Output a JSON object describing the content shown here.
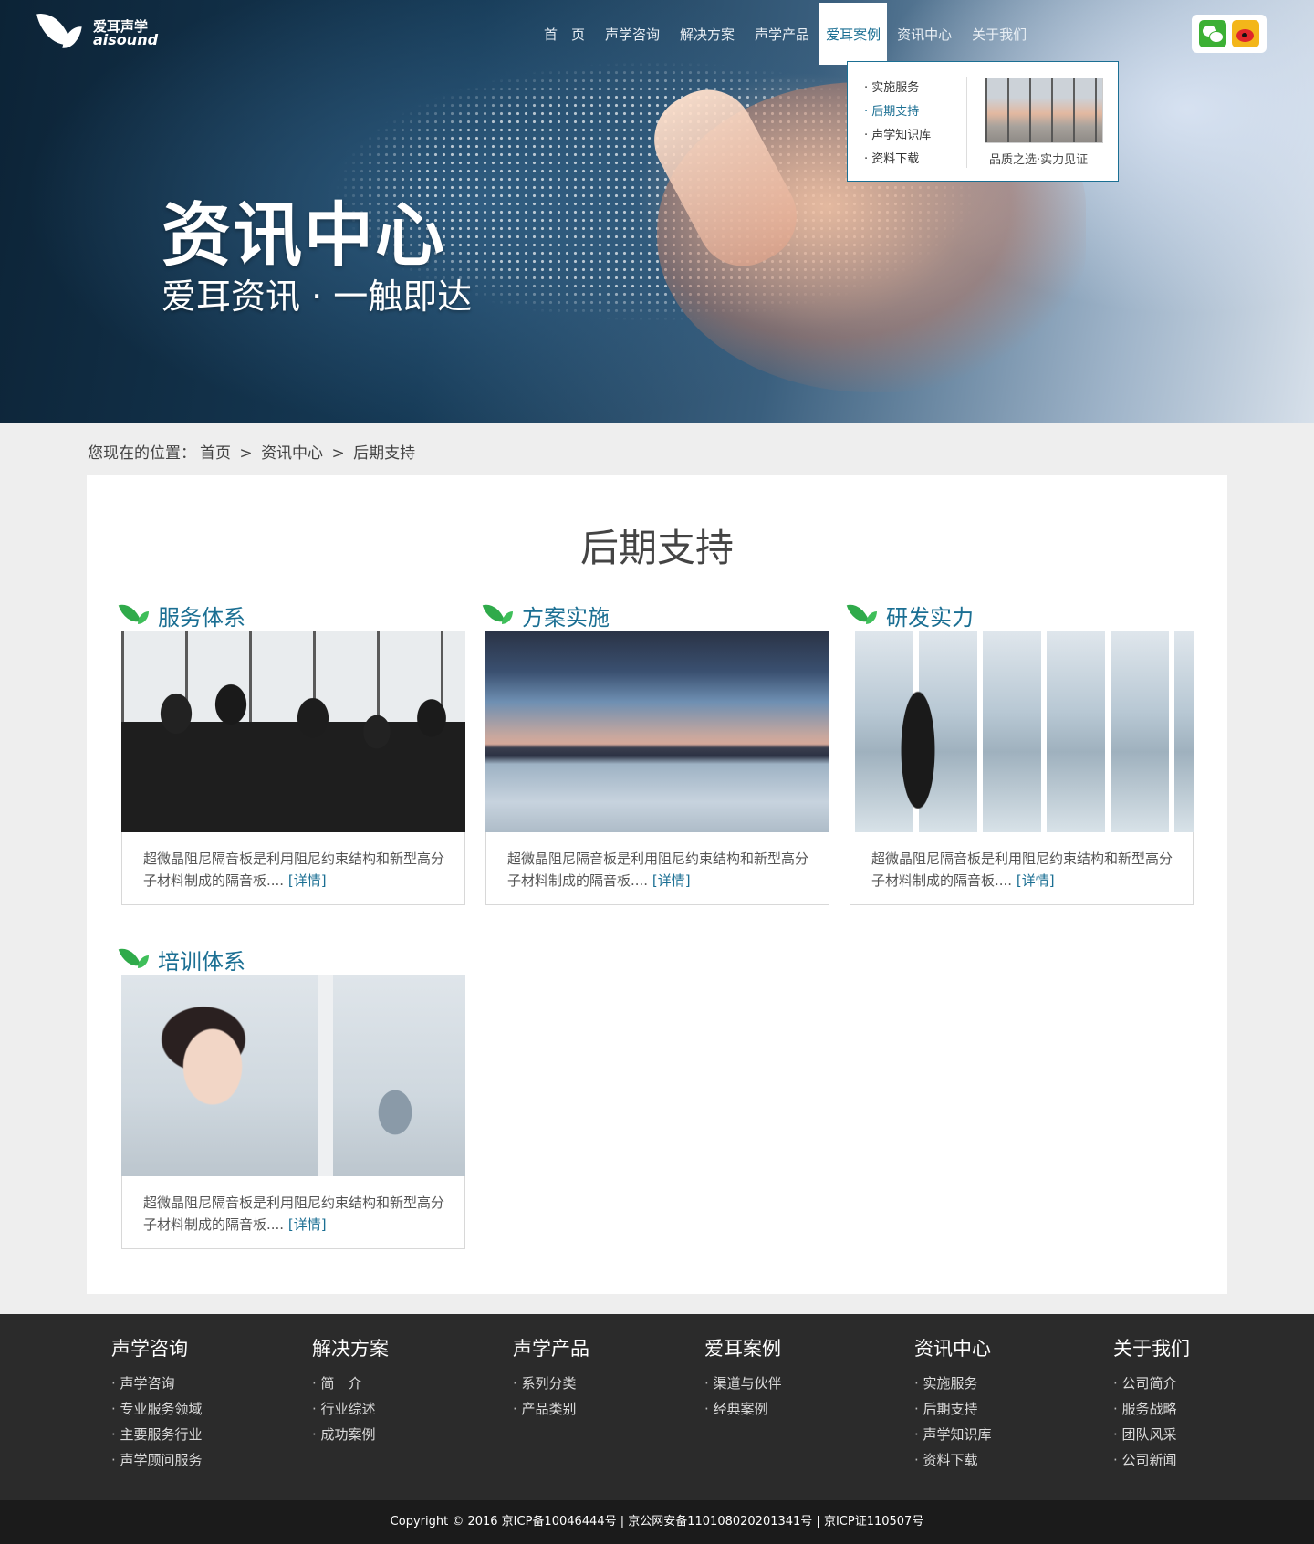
{
  "header": {
    "logo_cn": "爱耳声学",
    "logo_en": "aisound",
    "nav": [
      {
        "label": "首　页"
      },
      {
        "label": "声学咨询"
      },
      {
        "label": "解决方案"
      },
      {
        "label": "声学产品"
      },
      {
        "label": "爱耳案例"
      },
      {
        "label": "资讯中心"
      },
      {
        "label": "关于我们"
      }
    ],
    "active_nav": "爱耳案例",
    "dropdown": {
      "items": [
        {
          "label": "· 实施服务"
        },
        {
          "label": "· 后期支持"
        },
        {
          "label": "· 声学知识库"
        },
        {
          "label": "· 资料下载"
        }
      ],
      "active_item": "· 后期支持",
      "caption": "品质之选·实力见证"
    },
    "social": {
      "wechat_icon": "wechat-icon",
      "weibo_icon": "weibo-icon"
    }
  },
  "hero": {
    "title": "资讯中心",
    "subtitle": "爱耳资讯 · 一触即达"
  },
  "breadcrumb": {
    "prefix": "您现在的位置：",
    "items": [
      "首页",
      ">",
      "资讯中心",
      ">",
      "后期支持"
    ]
  },
  "main": {
    "title": "后期支持",
    "cards": [
      {
        "title": "服务体系",
        "desc": "超微晶阻尼隔音板是利用阻尼约束结构和新型高分子材料制成的隔音板....",
        "more": "[详情]"
      },
      {
        "title": "方案实施",
        "desc": "超微晶阻尼隔音板是利用阻尼约束结构和新型高分子材料制成的隔音板....",
        "more": "[详情]"
      },
      {
        "title": "研发实力",
        "desc": "超微晶阻尼隔音板是利用阻尼约束结构和新型高分子材料制成的隔音板....",
        "more": "[详情]"
      },
      {
        "title": "培训体系",
        "desc": "超微晶阻尼隔音板是利用阻尼约束结构和新型高分子材料制成的隔音板....",
        "more": "[详情]"
      }
    ]
  },
  "footer": {
    "columns": [
      {
        "heading": "声学咨询",
        "items": [
          "声学咨询",
          "专业服务领域",
          "主要服务行业",
          "声学顾问服务"
        ]
      },
      {
        "heading": "解决方案",
        "items": [
          "简　介",
          "行业综述",
          "成功案例"
        ]
      },
      {
        "heading": "声学产品",
        "items": [
          "系列分类",
          "产品类别"
        ]
      },
      {
        "heading": "爱耳案例",
        "items": [
          "渠道与伙伴",
          "经典案例"
        ]
      },
      {
        "heading": "资讯中心",
        "items": [
          "实施服务",
          "后期支持",
          "声学知识库",
          "资料下载"
        ]
      },
      {
        "heading": "关于我们",
        "items": [
          "公司简介",
          "服务战略",
          "团队风采",
          "公司新闻"
        ]
      }
    ],
    "copyright": "Copyright © 2016  京ICP备10046444号 | 京公网安备110108020201341号 | 京ICP证110507号"
  },
  "colors": {
    "accent": "#1b6f93",
    "leaf_green": "#2faa4a",
    "footer_bg": "#2b2b2b",
    "page_bg": "#eeeeee"
  }
}
